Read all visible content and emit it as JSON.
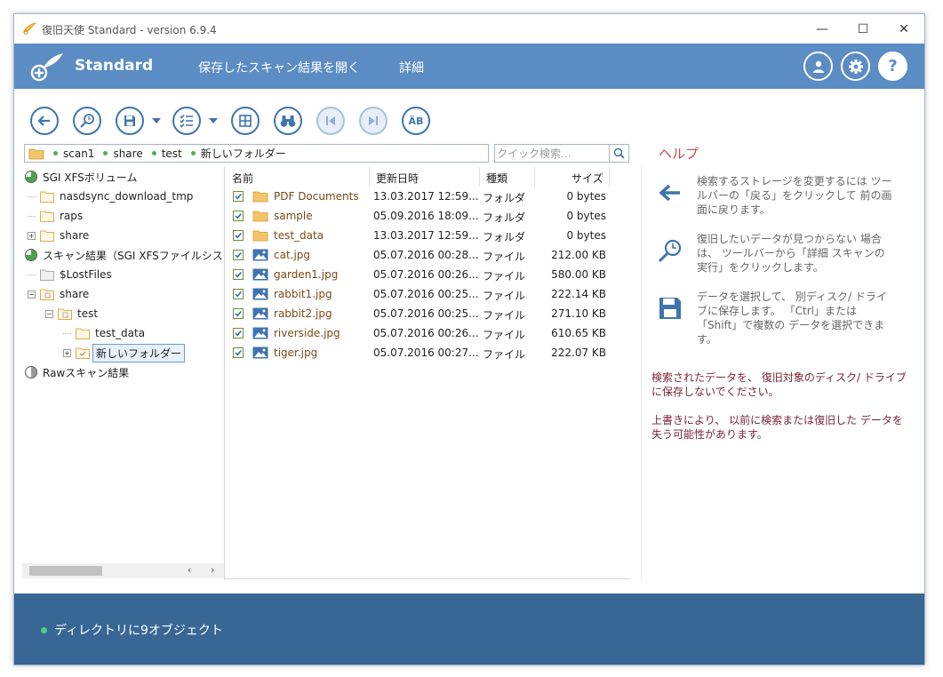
{
  "window": {
    "title": "復旧天使 Standard - version 6.9.4",
    "controls": {
      "minimize": "—",
      "maximize": "☐",
      "close": "✕"
    }
  },
  "appbar": {
    "brand": "Standard",
    "nav": [
      "保存したスキャン結果を開く",
      "詳細"
    ],
    "icons": [
      "user-icon",
      "settings-icon",
      "help-icon"
    ],
    "accent": "#5b8cc4"
  },
  "toolbar": {
    "buttons": [
      "back-icon",
      "detailed-scan-icon",
      "save-icon",
      "filter-list-icon",
      "view-grid-icon",
      "find-icon",
      "previous-icon",
      "next-icon",
      "case-sensitive-icon"
    ]
  },
  "path": {
    "segments": [
      "scan1",
      "share",
      "test",
      "新しいフォルダー"
    ]
  },
  "search": {
    "placeholder": "クイック検索..."
  },
  "tree": [
    {
      "label": "SGI XFSボリューム",
      "kind": "volume"
    },
    {
      "label": "nasdsync_download_tmp",
      "kind": "folder"
    },
    {
      "label": "raps",
      "kind": "folder"
    },
    {
      "label": "share",
      "kind": "folder"
    },
    {
      "label": "スキャン結果（SGI XFSファイルシス",
      "kind": "volume"
    },
    {
      "label": "$LostFiles",
      "kind": "folder"
    },
    {
      "label": "share",
      "kind": "folder"
    },
    {
      "label": "test",
      "kind": "folder"
    },
    {
      "label": "test_data",
      "kind": "folder"
    },
    {
      "label": "新しいフォルダー",
      "kind": "folder"
    },
    {
      "label": "Rawスキャン結果",
      "kind": "volume"
    }
  ],
  "list": {
    "headers": {
      "name": "名前",
      "date": "更新日時",
      "type": "種類",
      "size": "サイズ"
    },
    "rows": [
      {
        "name": "PDF Documents",
        "date": "13.03.2017 12:59...",
        "type": "フォルダ",
        "size": "0 bytes",
        "icon": "folder-icon"
      },
      {
        "name": "sample",
        "date": "05.09.2016 18:09...",
        "type": "フォルダ",
        "size": "0 bytes",
        "icon": "folder-icon"
      },
      {
        "name": "test_data",
        "date": "13.03.2017 12:59...",
        "type": "フォルダ",
        "size": "0 bytes",
        "icon": "folder-icon"
      },
      {
        "name": "cat.jpg",
        "date": "05.07.2016 00:28...",
        "type": "ファイル",
        "size": "212.00 KB",
        "icon": "image-icon"
      },
      {
        "name": "garden1.jpg",
        "date": "05.07.2016 00:26...",
        "type": "ファイル",
        "size": "580.00 KB",
        "icon": "image-icon"
      },
      {
        "name": "rabbit1.jpg",
        "date": "05.07.2016 00:25...",
        "type": "ファイル",
        "size": "222.14 KB",
        "icon": "image-icon"
      },
      {
        "name": "rabbit2.jpg",
        "date": "05.07.2016 00:25...",
        "type": "ファイル",
        "size": "271.10 KB",
        "icon": "image-icon"
      },
      {
        "name": "riverside.jpg",
        "date": "05.07.2016 00:26...",
        "type": "ファイル",
        "size": "610.65 KB",
        "icon": "image-icon"
      },
      {
        "name": "tiger.jpg",
        "date": "05.07.2016 00:27...",
        "type": "ファイル",
        "size": "222.07 KB",
        "icon": "image-icon"
      }
    ]
  },
  "help": {
    "title": "ヘルプ",
    "items": [
      {
        "icon": "back-arrow-icon",
        "text": "検索するストレージを変更するには ツールバーの「戻る」をクリックして 前の画面に戻ります。"
      },
      {
        "icon": "detailed-scan-icon",
        "text": "復旧したいデータが見つからない 場合は、 ツールバーから「詳細 スキャンの実行」をクリックします。"
      },
      {
        "icon": "save-icon",
        "text": "データを選択して、 別ディスク/ ドライブに保存します。 「Ctrl」または「Shift」で複数の データを選択できます。"
      }
    ],
    "warnings": [
      "検索されたデータを、 復旧対象のディスク/ ドライブに保存しないでください。",
      "上書きにより、 以前に検索または復旧した データを失う可能性があります。"
    ]
  },
  "status": {
    "text": "ディレクトリに9オブジェクト",
    "color": "#386796"
  }
}
